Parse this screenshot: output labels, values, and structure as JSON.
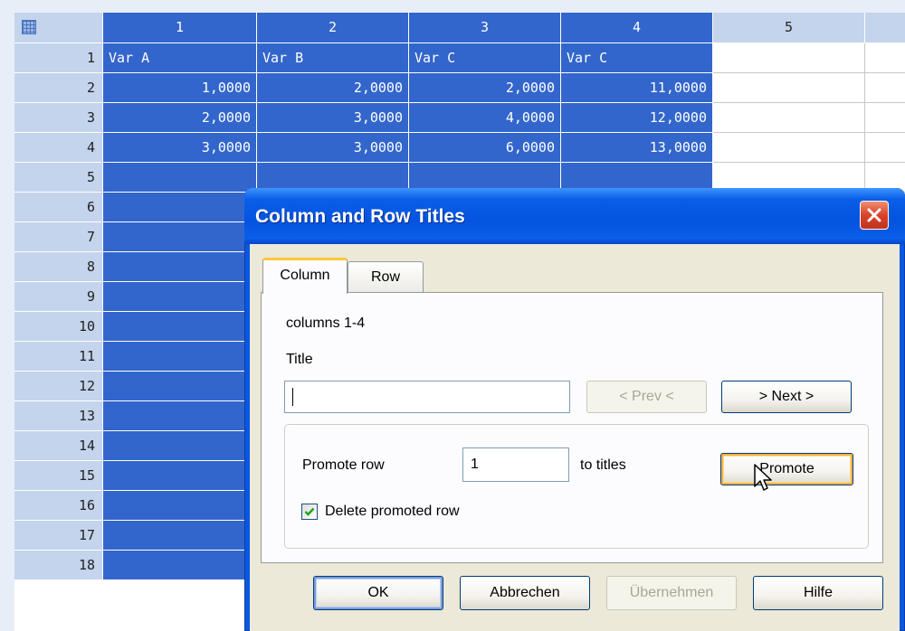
{
  "spreadsheet": {
    "column_headers": [
      {
        "label": "1",
        "selected": true
      },
      {
        "label": "2",
        "selected": true
      },
      {
        "label": "3",
        "selected": true
      },
      {
        "label": "4",
        "selected": true
      },
      {
        "label": "5",
        "selected": false
      }
    ],
    "row_headers": [
      "1",
      "2",
      "3",
      "4",
      "5",
      "6",
      "7",
      "8",
      "9",
      "10",
      "11",
      "12",
      "13",
      "14",
      "15",
      "16",
      "17",
      "18"
    ],
    "rows": [
      [
        "Var A",
        "Var B",
        "Var C",
        "Var C",
        ""
      ],
      [
        "1,0000",
        "2,0000",
        "2,0000",
        "11,0000",
        ""
      ],
      [
        "2,0000",
        "3,0000",
        "4,0000",
        "12,0000",
        ""
      ],
      [
        "3,0000",
        "3,0000",
        "6,0000",
        "13,0000",
        ""
      ]
    ],
    "colors": {
      "selection": "#3366cc",
      "header": "#c4d4ec"
    }
  },
  "dialog": {
    "title": "Column and Row Titles",
    "close_icon": "close-x-icon",
    "tabs": [
      {
        "label": "Column",
        "active": true
      },
      {
        "label": "Row",
        "active": false
      }
    ],
    "selection_info": "columns 1-4",
    "title_label": "Title",
    "title_value": "",
    "prev_button": "< Prev <",
    "next_button": "> Next >",
    "promote_row_label": "Promote row",
    "promote_row_value": "1",
    "to_titles_label": "to titles",
    "promote_button": "Promote",
    "delete_promoted_label": "Delete promoted row",
    "delete_promoted_checked": true,
    "ok_button": "OK",
    "cancel_button": "Abbrechen",
    "apply_button": "Übernehmen",
    "help_button": "Hilfe"
  }
}
